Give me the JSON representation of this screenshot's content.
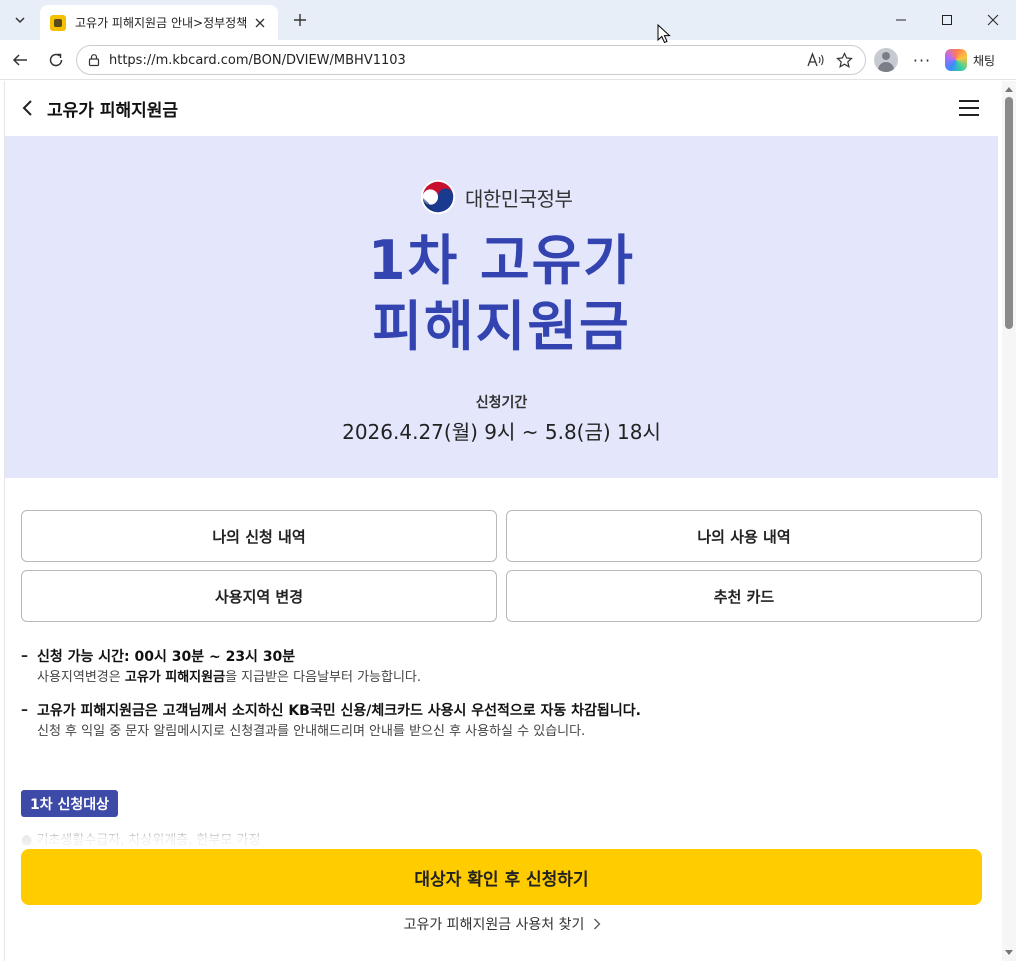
{
  "browser": {
    "tab_title": "고유가 피해지원금 안내>정부정책",
    "url": "https://m.kbcard.com/BON/DVIEW/MBHV1103",
    "copilot_label": "채팅",
    "more_label": "···"
  },
  "header": {
    "title": "고유가 피해지원금"
  },
  "hero": {
    "gov_name": "대한민국정부",
    "title_line1": "1차 고유가",
    "title_line2": "피해지원금",
    "period_label": "신청기간",
    "period_value": "2026.4.27(월) 9시 ~ 5.8(금) 18시",
    "title_color": "#3344b0",
    "background": "#e4e7fc"
  },
  "buttons": {
    "my_applications": "나의 신청 내역",
    "my_usage": "나의 사용 내역",
    "change_region": "사용지역 변경",
    "recommended_cards": "추천 카드"
  },
  "notes": [
    {
      "main": "신청 가능 시간: 00시 30분 ~ 23시 30분",
      "sub_prefix": "사용지역변경은 ",
      "sub_bold": "고유가 피해지원금",
      "sub_suffix": "을 지급받은 다음날부터 가능합니다."
    },
    {
      "main": "고유가 피해지원금은 고객님께서 소지하신 KB국민 신용/체크카드 사용시 우선적으로 자동 차감됩니다.",
      "sub": "신청 후 익일 중 문자 알림메시지로 신청결과를 안내해드리며 안내를 받으신 후 사용하실 수 있습니다."
    }
  ],
  "note_dash": "–",
  "badge": "1차 신청대상",
  "faded_text": "● 기초생활수급자, 차상위계층, 한부모 가정",
  "cta": {
    "label": "대상자 확인 후 신청하기",
    "color": "#ffcc00"
  },
  "place_link": "고유가 피해지원금 사용처 찾기"
}
